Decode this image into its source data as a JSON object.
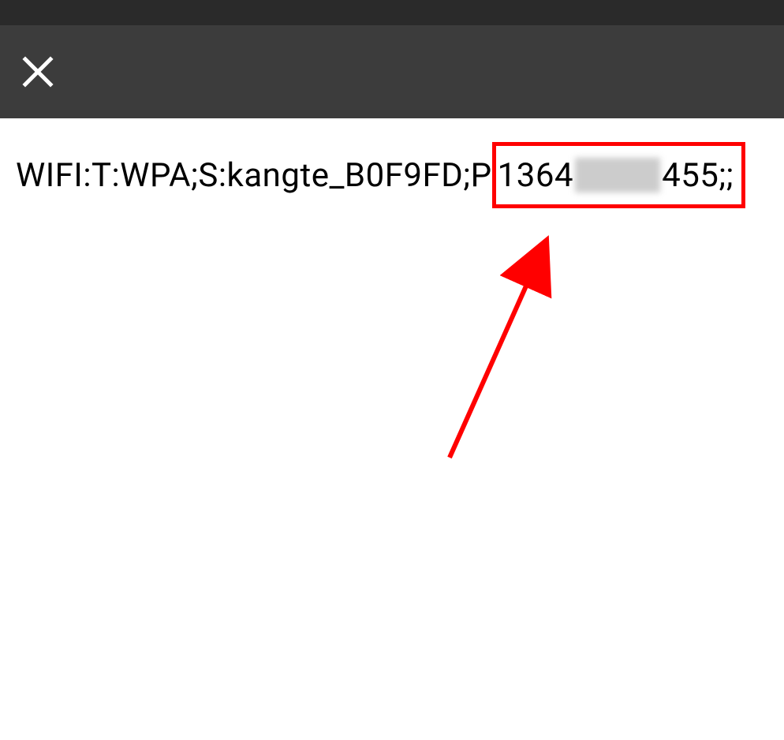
{
  "wifi_string": {
    "prefix": "WIFI:T:WPA;S:kangte_B0F9FD;P",
    "highlighted_start": "1364",
    "highlighted_end": "455;;"
  }
}
